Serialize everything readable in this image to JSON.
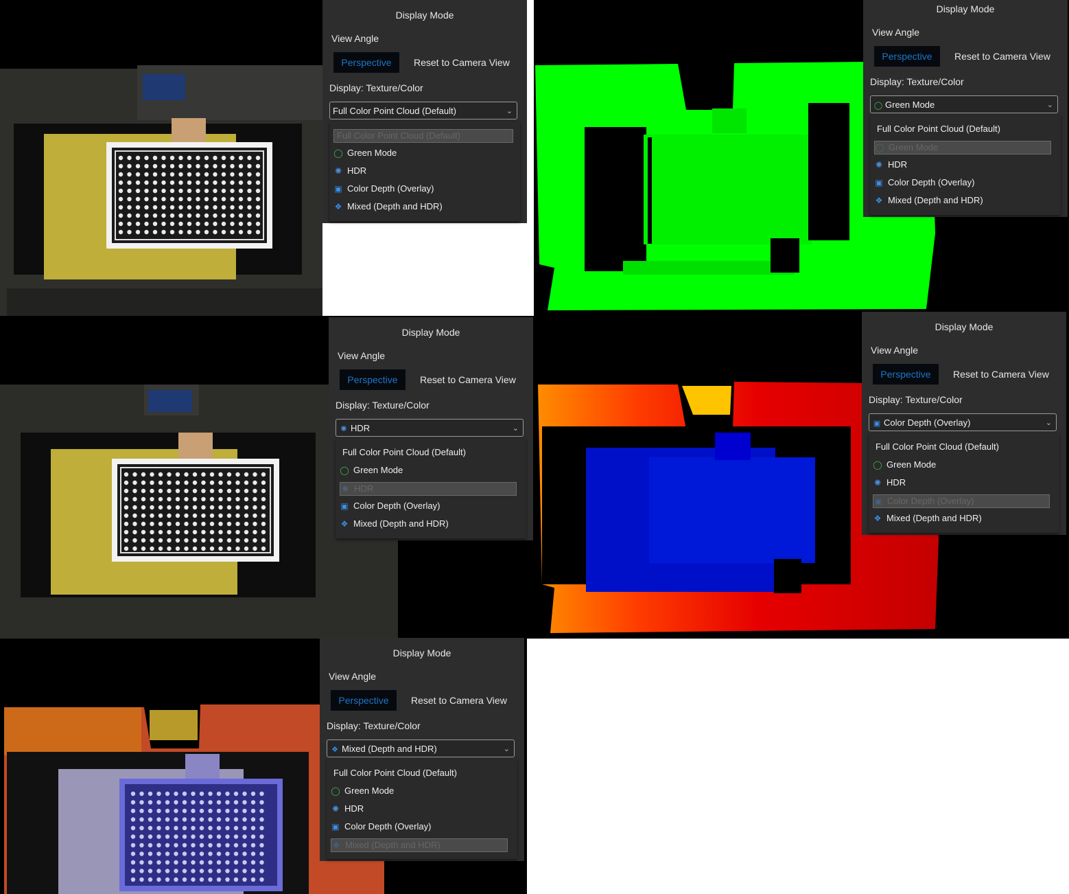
{
  "panel": {
    "title": "Display Mode",
    "view_angle_label": "View Angle",
    "perspective_button": "Perspective",
    "reset_button": "Reset to Camera View",
    "display_label": "Display: Texture/Color"
  },
  "options": [
    {
      "label": "Full Color Point Cloud (Default)",
      "icon": ""
    },
    {
      "label": "Green Mode",
      "icon": "green-mode-icon"
    },
    {
      "label": "HDR",
      "icon": "hdr-icon"
    },
    {
      "label": "Color Depth (Overlay)",
      "icon": "color-depth-icon"
    },
    {
      "label": "Mixed (Depth and HDR)",
      "icon": "mixed-icon"
    }
  ],
  "views": [
    {
      "selected_label": "Full Color Point Cloud (Default)",
      "selected_index": 0
    },
    {
      "selected_label": "Green Mode",
      "selected_index": 1
    },
    {
      "selected_label": "HDR",
      "selected_index": 2
    },
    {
      "selected_label": "Color Depth (Overlay)",
      "selected_index": 3
    },
    {
      "selected_label": "Mixed (Depth and HDR)",
      "selected_index": 4
    }
  ],
  "colors": {
    "panel_bg": "#2d2d2d",
    "perspective_text": "#1e76c8",
    "green_mode": "#00ff00",
    "depth_blue": "#0000c8",
    "depth_red": "#e60000"
  }
}
